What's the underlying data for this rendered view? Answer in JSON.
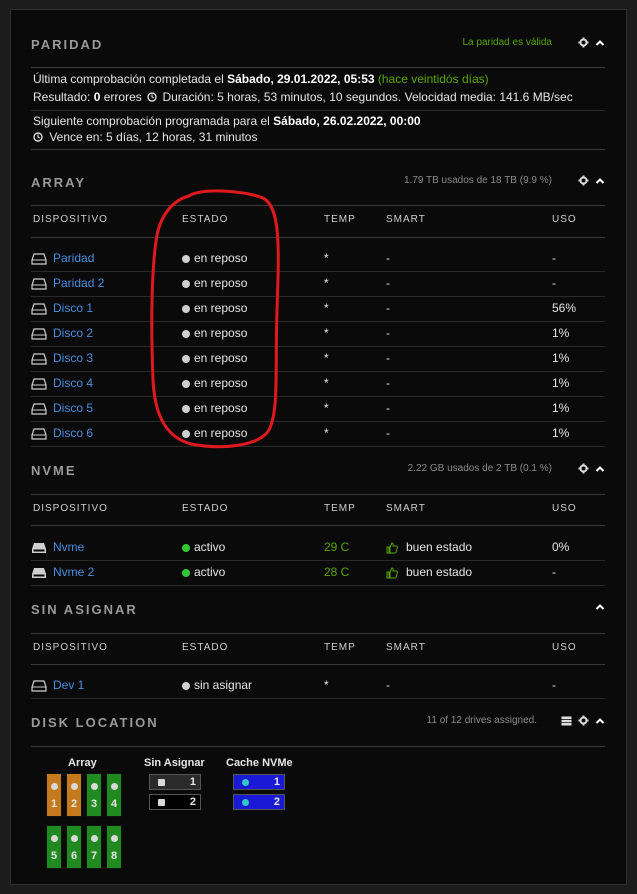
{
  "parity": {
    "title": "PARIDAD",
    "status": "La paridad es válida",
    "line1_prefix": "Última comprobación completada el",
    "line1_date": "Sábado, 29.01.2022, 05:53",
    "line1_ago": "(hace veintidós días)",
    "line2_result_label": "Resultado:",
    "line2_errors": "0",
    "line2_errors_label": "errores",
    "line2_duration": "Duración: 5 horas, 53 minutos, 10 segundos. Velocidad media: 141.6 MB/sec",
    "line3_prefix": "Siguiente comprobación programada para el",
    "line3_date": "Sábado, 26.02.2022, 00:00",
    "line4": "Vence en: 5 días, 12 horas, 31 minutos"
  },
  "array": {
    "title": "ARRAY",
    "usage": "1.79 TB usados de 18 TB (9.9 %)",
    "headers": {
      "dev": "DISPOSITIVO",
      "state": "ESTADO",
      "temp": "TEMP",
      "smart": "SMART",
      "use": "USO"
    },
    "rows": [
      {
        "name": "Paridad",
        "state": "en reposo",
        "temp": "*",
        "smart": "-",
        "use": "-"
      },
      {
        "name": "Paridad 2",
        "state": "en reposo",
        "temp": "*",
        "smart": "-",
        "use": "-"
      },
      {
        "name": "Disco 1",
        "state": "en reposo",
        "temp": "*",
        "smart": "-",
        "use": "56%"
      },
      {
        "name": "Disco 2",
        "state": "en reposo",
        "temp": "*",
        "smart": "-",
        "use": "1%"
      },
      {
        "name": "Disco 3",
        "state": "en reposo",
        "temp": "*",
        "smart": "-",
        "use": "1%"
      },
      {
        "name": "Disco 4",
        "state": "en reposo",
        "temp": "*",
        "smart": "-",
        "use": "1%"
      },
      {
        "name": "Disco 5",
        "state": "en reposo",
        "temp": "*",
        "smart": "-",
        "use": "1%"
      },
      {
        "name": "Disco 6",
        "state": "en reposo",
        "temp": "*",
        "smart": "-",
        "use": "1%"
      }
    ]
  },
  "nvme": {
    "title": "NVME",
    "usage": "2.22 GB usados de 2 TB (0.1 %)",
    "headers": {
      "dev": "DISPOSITIVO",
      "state": "ESTADO",
      "temp": "TEMP",
      "smart": "SMART",
      "use": "USO"
    },
    "rows": [
      {
        "name": "Nvme",
        "state": "activo",
        "temp": "29 C",
        "smart": "buen estado",
        "use": "0%"
      },
      {
        "name": "Nvme 2",
        "state": "activo",
        "temp": "28 C",
        "smart": "buen estado",
        "use": "-"
      }
    ]
  },
  "unassigned": {
    "title": "SIN ASIGNAR",
    "headers": {
      "dev": "DISPOSITIVO",
      "state": "ESTADO",
      "temp": "TEMP",
      "smart": "SMART",
      "use": "USO"
    },
    "rows": [
      {
        "name": "Dev 1",
        "state": "sin asignar",
        "temp": "*",
        "smart": "-",
        "use": "-"
      }
    ]
  },
  "disk_location": {
    "title": "DISK LOCATION",
    "summary": "11 of 12 drives assigned.",
    "groups": {
      "array": "Array",
      "unassigned": "Sin Asignar",
      "cache": "Cache NVMe"
    },
    "array_bays": [
      "1",
      "2",
      "3",
      "4",
      "5",
      "6",
      "7",
      "8"
    ],
    "unassigned_slots": [
      "1",
      "2"
    ],
    "cache_slots": [
      "1",
      "2"
    ]
  },
  "colors": {
    "link": "#4a8fdf",
    "ok_green": "#56a800",
    "parity_bay": "#c57a1e",
    "data_bay": "#1f8a1f",
    "cache_slot": "#1a1ad6",
    "annotation_red": "#e0191e"
  }
}
